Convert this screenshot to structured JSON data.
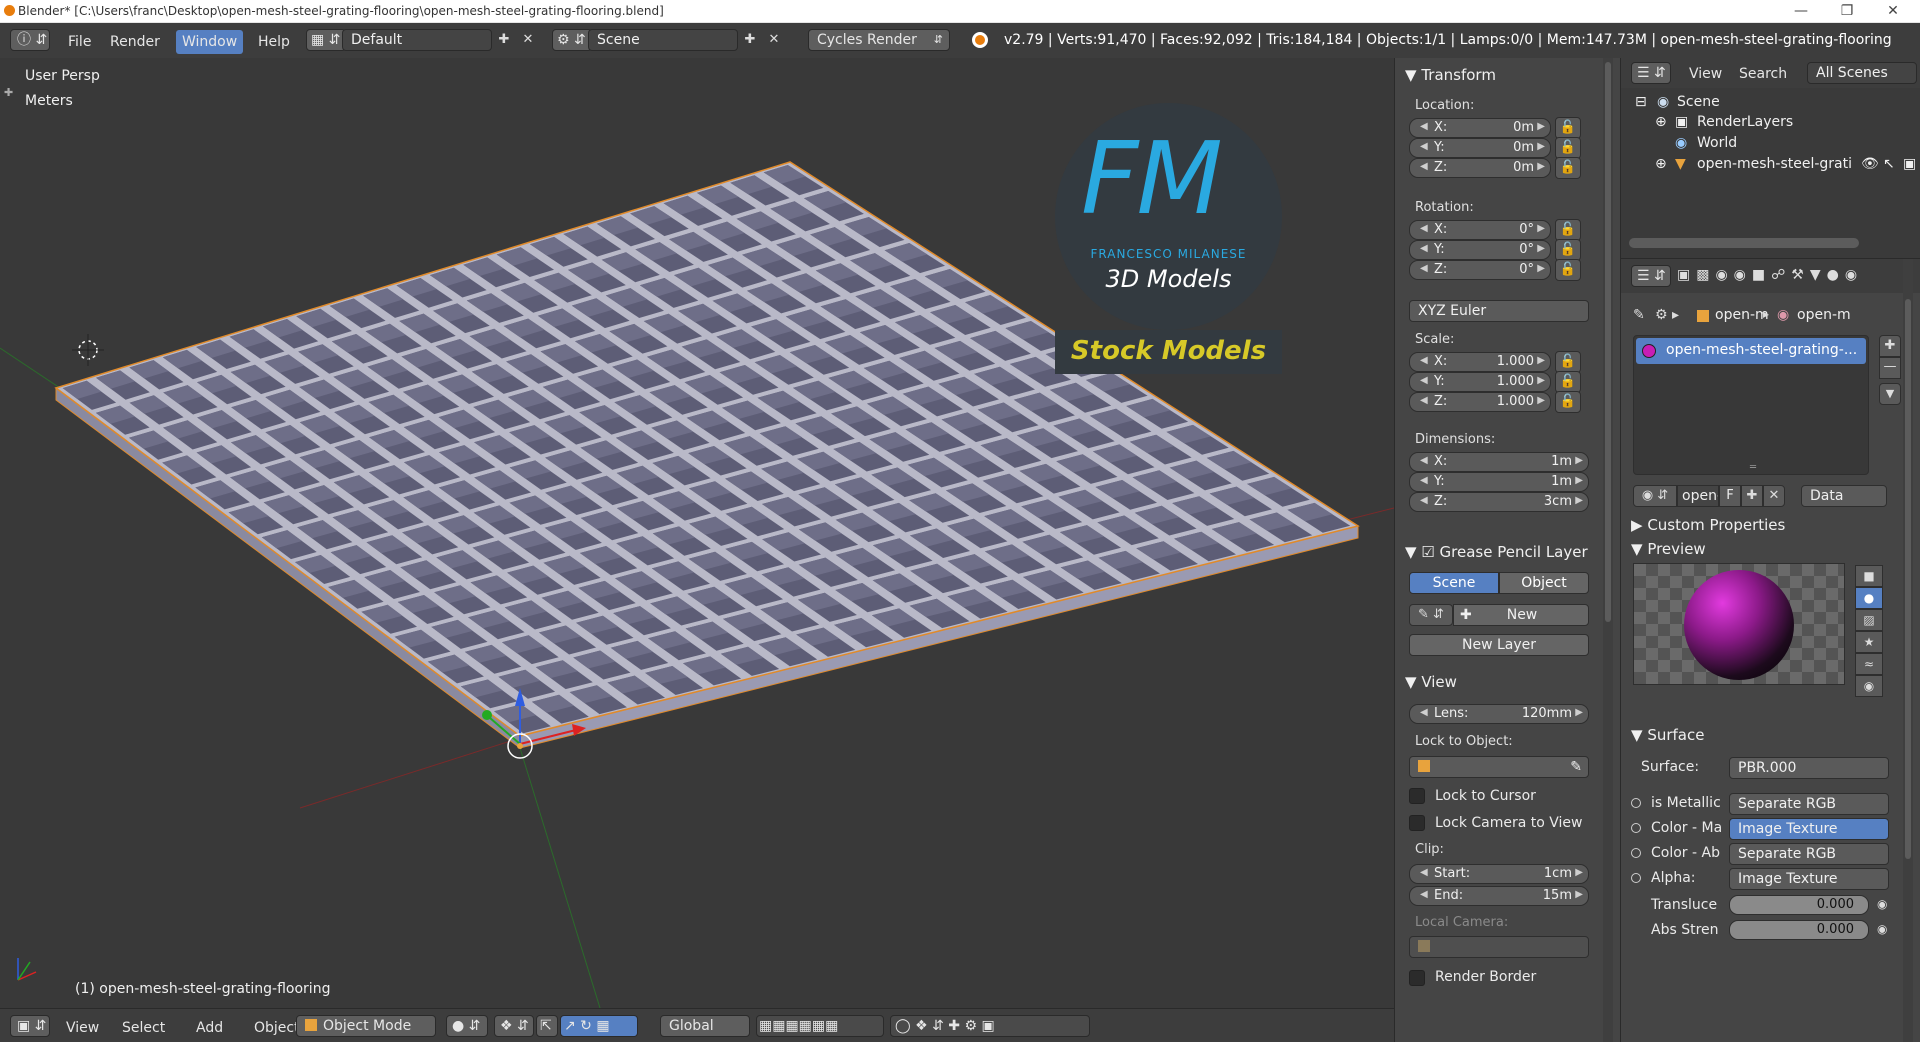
{
  "window": {
    "title": "Blender* [C:\\Users\\franc\\Desktop\\open-mesh-steel-grating-flooring\\open-mesh-steel-grating-flooring.blend]",
    "controls": [
      "minimize-icon",
      "maximize-icon",
      "close-icon"
    ]
  },
  "info_header": {
    "menus": [
      "File",
      "Render",
      "Window",
      "Help"
    ],
    "active_menu": "Window",
    "layout": "Default",
    "scene": "Scene",
    "engine": "Cycles Render",
    "stats": "v2.79 | Verts:91,470 | Faces:92,092 | Tris:184,184 | Objects:1/1 | Lamps:0/0 | Mem:147.73M | open-mesh-steel-grating-flooring"
  },
  "viewport": {
    "view_name": "User Persp",
    "units": "Meters",
    "object_label": "(1) open-mesh-steel-grating-flooring",
    "logo": {
      "initials": "FM",
      "brand": "FRANCESCO MILANESE",
      "subtitle": "3D Models",
      "banner": "Stock Models"
    }
  },
  "viewport_header": {
    "menus": [
      "View",
      "Select",
      "Add",
      "Object"
    ],
    "mode": "Object Mode",
    "orientation": "Global"
  },
  "transform": {
    "title": "Transform",
    "location_label": "Location:",
    "location": [
      {
        "k": "X:",
        "v": "0m"
      },
      {
        "k": "Y:",
        "v": "0m"
      },
      {
        "k": "Z:",
        "v": "0m"
      }
    ],
    "rotation_label": "Rotation:",
    "rotation": [
      {
        "k": "X:",
        "v": "0°"
      },
      {
        "k": "Y:",
        "v": "0°"
      },
      {
        "k": "Z:",
        "v": "0°"
      }
    ],
    "rotation_mode": "XYZ Euler",
    "scale_label": "Scale:",
    "scale": [
      {
        "k": "X:",
        "v": "1.000"
      },
      {
        "k": "Y:",
        "v": "1.000"
      },
      {
        "k": "Z:",
        "v": "1.000"
      }
    ],
    "dimensions_label": "Dimensions:",
    "dimensions": [
      {
        "k": "X:",
        "v": "1m"
      },
      {
        "k": "Y:",
        "v": "1m"
      },
      {
        "k": "Z:",
        "v": "3cm"
      }
    ]
  },
  "grease_pencil": {
    "title": "Grease Pencil Layer",
    "tab_scene": "Scene",
    "tab_object": "Object",
    "new_label": "New",
    "new_layer_label": "New Layer"
  },
  "view_panel": {
    "title": "View",
    "lens_label": "Lens:",
    "lens_value": "120mm",
    "lock_to_object": "Lock to Object:",
    "lock_to_cursor": "Lock to Cursor",
    "lock_camera": "Lock Camera to View",
    "clip_label": "Clip:",
    "clip_start_label": "Start:",
    "clip_start": "1cm",
    "clip_end_label": "End:",
    "clip_end": "15m",
    "local_camera": "Local Camera:",
    "render_border": "Render Border"
  },
  "outliner": {
    "menus": [
      "View",
      "Search"
    ],
    "display": "All Scenes",
    "rows": [
      "Scene",
      "RenderLayers",
      "World",
      "open-mesh-steel-grati"
    ]
  },
  "properties": {
    "breadcrumb": [
      "open-m",
      "open-m"
    ],
    "material_slot": "open-mesh-steel-grating-...",
    "material_name": "open-",
    "fake_user": "F",
    "link": "Data",
    "custom_properties": "Custom Properties",
    "preview": "Preview",
    "surface_title": "Surface",
    "surface_label": "Surface:",
    "surface_value": "PBR.000",
    "inputs": [
      {
        "label": "is Metallic",
        "value": "Separate RGB",
        "active": false
      },
      {
        "label": "Color - Ma",
        "value": "Image Texture",
        "active": true
      },
      {
        "label": "Color - Ab",
        "value": "Separate RGB",
        "active": false
      },
      {
        "label": "Alpha:",
        "value": "Image Texture",
        "active": false
      }
    ],
    "sliders": [
      {
        "label": "Transluce",
        "value": "0.000"
      },
      {
        "label": "Abs Stren",
        "value": "0.000"
      }
    ]
  },
  "colors": {
    "accent": "#5680c2",
    "viewport_bg": "#393939",
    "panel_bg": "#454545",
    "logo_blue": "#2aa9e0",
    "banner_text": "#d7c928"
  }
}
